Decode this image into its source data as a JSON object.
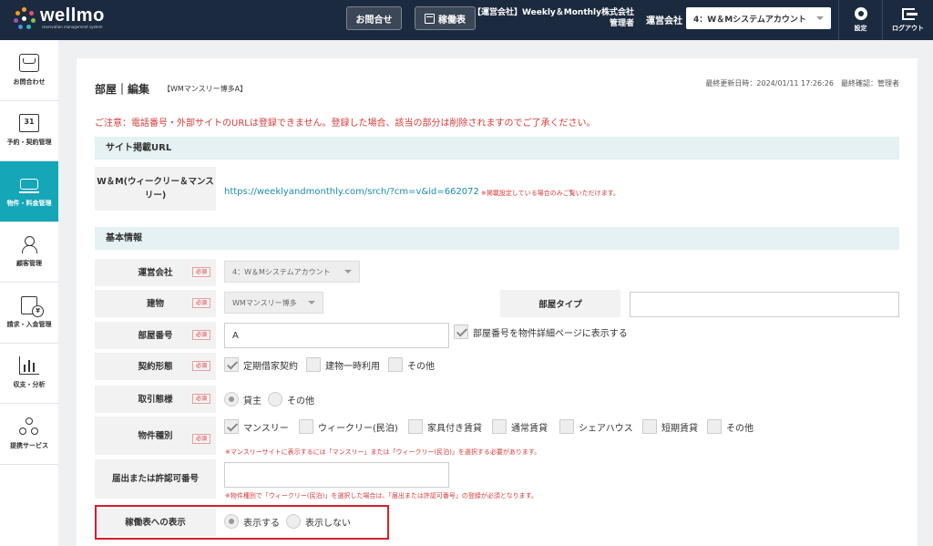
{
  "header": {
    "logo_name": "wellmo",
    "logo_sub": "reservation management system",
    "inquiry_label": "お問合せ",
    "schedule_label": "稼働表",
    "company_line1": "【運営会社】Weekly＆Monthly株式会社",
    "company_line2": "管理者",
    "operator_label": "運営会社",
    "operator_value": "4：W＆Mシステムアカウント",
    "settings_label": "設定",
    "logout_label": "ログアウト"
  },
  "sidebar": {
    "items": [
      {
        "label": "お問合わせ",
        "icon": "mail-icon"
      },
      {
        "label": "予約・契約管理",
        "icon": "calendar-icon",
        "glyph": "31"
      },
      {
        "label": "物件・料金管理",
        "icon": "bed-icon"
      },
      {
        "label": "顧客管理",
        "icon": "user-icon"
      },
      {
        "label": "請求・入金管理",
        "icon": "invoice-icon"
      },
      {
        "label": "収支・分析",
        "icon": "bar-chart-icon"
      },
      {
        "label": "提携サービス",
        "icon": "share-icon"
      }
    ],
    "active_index": 2
  },
  "page": {
    "title": "部屋｜編集",
    "subtitle": "【WMマンスリー博多A】",
    "last_update": "最終更新日時：2024/01/11 17:26:26　最終確認：管理者",
    "notice": "ご注意：電話番号・外部サイトのURLは登録できません。登録した場合、該当の部分は削除されますのでご了承ください。"
  },
  "site_section": {
    "title": "サイト掲載URL",
    "label": "W＆M(ウィークリー＆マンスリー)",
    "url": "https://weeklyandmonthly.com/srch/?cm=v&id=662072",
    "url_note": "※掲載設定している場合のみご覧いただけます。"
  },
  "basic_section": {
    "title": "基本情報",
    "required_badge": "必須",
    "operator": {
      "label": "運営会社",
      "value": "4：W＆Mシステムアカウント"
    },
    "building": {
      "label": "建物",
      "value": "WMマンスリー博多"
    },
    "room_type": {
      "label": "部屋タイプ",
      "value": ""
    },
    "room_number": {
      "label": "部屋番号",
      "value": "A",
      "show_label": "部屋番号を物件詳細ページに表示する"
    },
    "contract": {
      "label": "契約形態",
      "options": [
        "定期借家契約",
        "建物一時利用",
        "その他"
      ]
    },
    "deal": {
      "label": "取引態様",
      "options": [
        "貸主",
        "その他"
      ]
    },
    "property_type": {
      "label": "物件種別",
      "options": [
        "マンスリー",
        "ウィークリー(民泊)",
        "家具付き賃貸",
        "通常賃貸",
        "シェアハウス",
        "短期賃貸",
        "その他"
      ],
      "hint": "※マンスリーサイトに表示するには「マンスリー」または「ウィークリー(民泊)」を選択する必要があります。"
    },
    "license": {
      "label": "届出または許認可番号",
      "value": "",
      "hint": "※物件種別で「ウィークリー(民泊)」を選択した場合は、「届出または許認可番号」の登録が必須となります。"
    },
    "schedule_display": {
      "label": "稼働表への表示",
      "options": [
        "表示する",
        "表示しない"
      ]
    }
  }
}
